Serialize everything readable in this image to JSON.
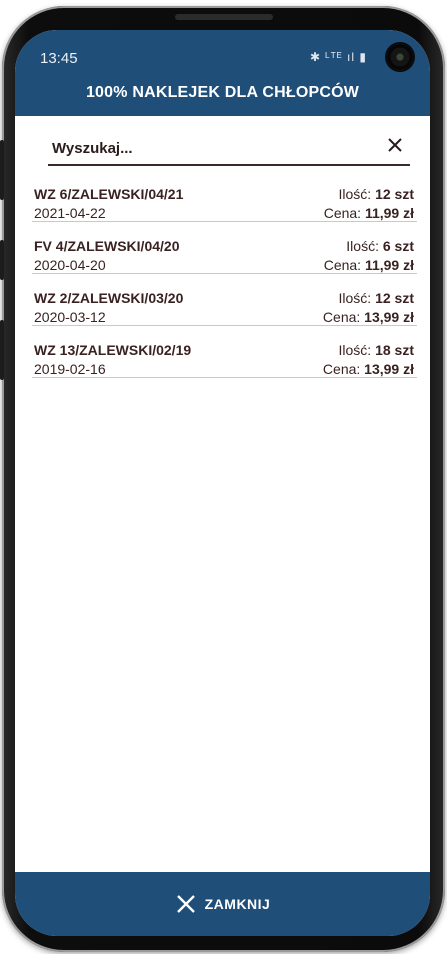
{
  "status_bar": {
    "time": "13:45",
    "icons": "✱ ᴸᵀᴱ ıl ▮"
  },
  "header": {
    "title": "100% NAKLEJEK DLA CHŁOPCÓW"
  },
  "search": {
    "placeholder": "Wyszukaj...",
    "value": "",
    "clear_icon": "close-icon"
  },
  "list": {
    "qty_label": "Ilość:",
    "price_label": "Cena:",
    "items": [
      {
        "number": "WZ 6/ZALEWSKI/04/21",
        "date": "2021-04-22",
        "qty": "12 szt",
        "price": "11,99 zł"
      },
      {
        "number": "FV 4/ZALEWSKI/04/20",
        "date": "2020-04-20",
        "qty": "6 szt",
        "price": "11,99 zł"
      },
      {
        "number": "WZ 2/ZALEWSKI/03/20",
        "date": "2020-03-12",
        "qty": "12 szt",
        "price": "13,99 zł"
      },
      {
        "number": "WZ 13/ZALEWSKI/02/19",
        "date": "2019-02-16",
        "qty": "18 szt",
        "price": "13,99 zł"
      }
    ]
  },
  "footer": {
    "close_label": "ZAMKNIJ",
    "close_icon": "close-icon"
  },
  "colors": {
    "accent": "#1f4e79",
    "text": "#3a2222",
    "divider": "#c9c9c9"
  }
}
